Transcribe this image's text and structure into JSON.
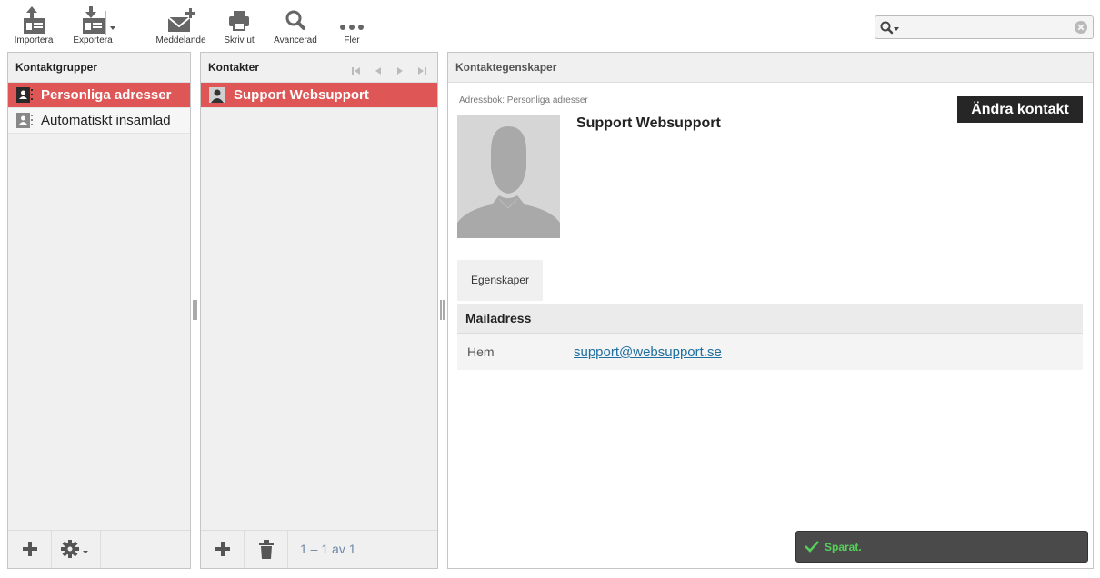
{
  "toolbar": {
    "import_label": "Importera",
    "export_label": "Exportera",
    "compose_label": "Meddelande",
    "print_label": "Skriv ut",
    "advanced_label": "Avancerad",
    "more_label": "Fler"
  },
  "search": {
    "value": "",
    "placeholder": ""
  },
  "groups": {
    "title": "Kontaktgrupper",
    "items": [
      {
        "label": "Personliga adresser",
        "selected": true
      },
      {
        "label": "Automatiskt insamlad",
        "selected": false
      }
    ]
  },
  "contacts": {
    "title": "Kontakter",
    "items": [
      {
        "label": "Support Websupport",
        "selected": true
      }
    ],
    "pager": "1 – 1 av 1"
  },
  "properties": {
    "title": "Kontaktegenskaper",
    "address_book": "Adressbok: Personliga adresser",
    "edit_label": "Ändra kontakt",
    "name": "Support Websupport",
    "tab_label": "Egenskaper",
    "section_title": "Mailadress",
    "email_type": "Hem",
    "email": "support@websupport.se"
  },
  "toast": {
    "message": "Sparat."
  },
  "colors": {
    "accent": "#de5656",
    "toast_text": "#55d05a",
    "link": "#1f6fa0"
  },
  "icons": [
    "import-icon",
    "export-icon",
    "compose-icon",
    "print-icon",
    "search-icon",
    "more-icon",
    "addressbook-icon",
    "person-icon",
    "add-icon",
    "gear-icon",
    "trash-icon",
    "first-page-icon",
    "prev-page-icon",
    "next-page-icon",
    "last-page-icon",
    "check-icon"
  ]
}
